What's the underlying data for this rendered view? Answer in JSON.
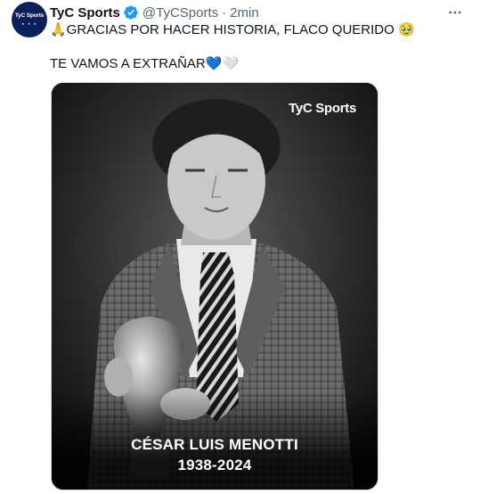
{
  "tweet": {
    "avatar": {
      "logo_text": "TyC Sports",
      "stars": "★ ★ ★",
      "accent": "#0b1f5c"
    },
    "display_name": "TyC Sports",
    "handle": "@TyCSports",
    "separator": "·",
    "time": "2min",
    "verified_icon": "verified-badge",
    "more_icon": "more-dots",
    "line1": "🙏GRACIAS POR HACER HISTORIA, FLACO QUERIDO 🥹",
    "line2": "TE VAMOS A EXTRAÑAR💙🤍",
    "media": {
      "brand": "TyC Sports",
      "name": "CÉSAR LUIS MENOTTI",
      "years": "1938-2024"
    }
  },
  "colors": {
    "text": "#0f1419",
    "muted": "#536471",
    "verified": "#1d9bf0"
  }
}
